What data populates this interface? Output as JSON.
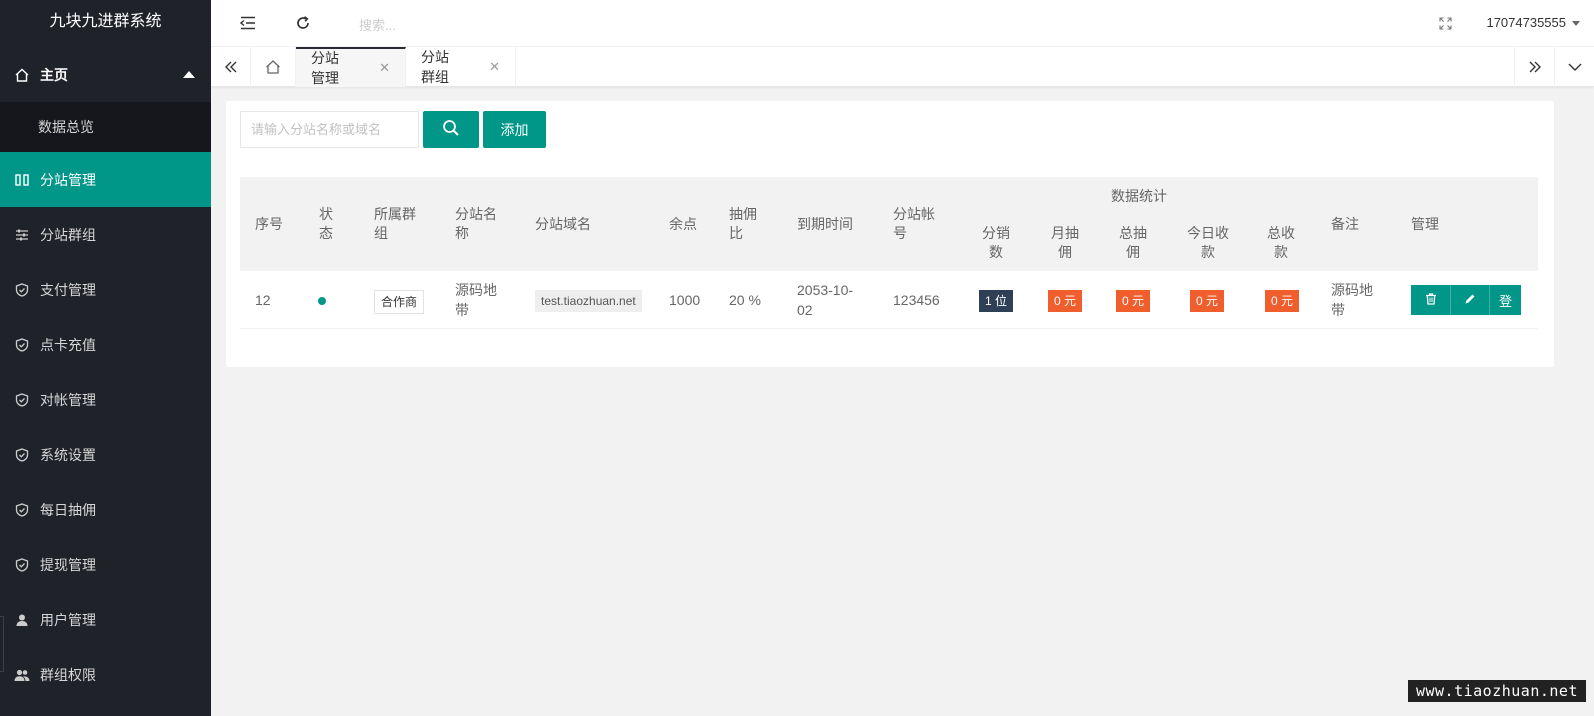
{
  "app": {
    "title": "九块九进群系统"
  },
  "sidebar": {
    "home": "主页",
    "home_sub": "数据总览",
    "items": [
      {
        "label": "分站管理",
        "icon": "columns-icon",
        "active": true
      },
      {
        "label": "分站群组",
        "icon": "sliders-icon"
      },
      {
        "label": "支付管理",
        "icon": "shield-check-icon"
      },
      {
        "label": "点卡充值",
        "icon": "shield-check-icon"
      },
      {
        "label": "对帐管理",
        "icon": "shield-check-icon"
      },
      {
        "label": "系统设置",
        "icon": "shield-check-icon"
      },
      {
        "label": "每日抽佣",
        "icon": "shield-check-icon"
      },
      {
        "label": "提现管理",
        "icon": "shield-check-icon"
      },
      {
        "label": "用户管理",
        "icon": "user-icon"
      },
      {
        "label": "群组权限",
        "icon": "users-icon"
      }
    ]
  },
  "header": {
    "search_placeholder": "搜索...",
    "user": "17074735555"
  },
  "tabs": [
    {
      "label": "分站管理",
      "active": true
    },
    {
      "label": "分站群组",
      "active": false
    }
  ],
  "toolbar": {
    "search_placeholder": "请输入分站名称或域名",
    "add_label": "添加"
  },
  "table": {
    "headers": {
      "index": "序号",
      "status": "状态",
      "group": "所属群组",
      "name": "分站名称",
      "domain": "分站域名",
      "balance": "余点",
      "commission": "抽佣比",
      "expire": "到期时间",
      "account": "分站帐号",
      "stats": "数据统计",
      "distributors": "分销数",
      "monthly": "月抽佣",
      "total_commission": "总抽佣",
      "today_income": "今日收款",
      "total_income": "总收款",
      "note": "备注",
      "manage": "管理"
    },
    "rows": [
      {
        "index": "12",
        "group": "合作商",
        "name": "源码地带",
        "domain": "test.tiaozhuan.net",
        "balance": "1000",
        "commission": "20 %",
        "expire": "2053-10-02",
        "account": "123456",
        "distributors": "1 位",
        "monthly": "0 元",
        "total_commission": "0 元",
        "today_income": "0 元",
        "total_income": "0 元",
        "note": "源码地带",
        "login_label": "登"
      }
    ]
  },
  "watermark": "www.tiaozhuan.net",
  "colors": {
    "accent": "#009688",
    "sidebar": "#20222a",
    "badge_dark": "#2f4056",
    "badge_orange": "#f05e2e"
  }
}
